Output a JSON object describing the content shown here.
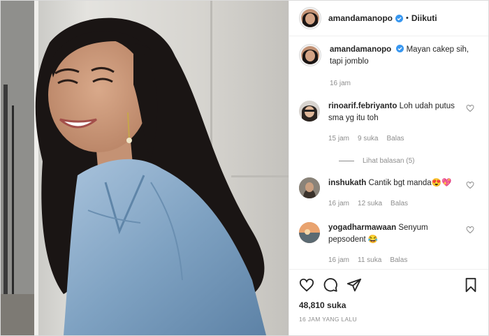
{
  "post": {
    "username": "amandamanopo",
    "follow_status": "Diikuti",
    "separator": "•"
  },
  "caption": {
    "username": "amandamanopo",
    "text": "Mayan cakep sih, tapi jomblo",
    "time": "16 jam"
  },
  "comments": [
    {
      "username": "rinoarif.febriyanto",
      "text": "Loh udah putus sma yg itu toh",
      "time": "15 jam",
      "likes": "9 suka",
      "reply": "Balas"
    },
    {
      "username": "inshukath",
      "text": "Cantik bgt manda😍💖",
      "time": "16 jam",
      "likes": "12 suka",
      "reply": "Balas"
    },
    {
      "username": "yogadharmawaan",
      "text": "Senyum pepsodent 😂",
      "time": "16 jam",
      "likes": "11 suka",
      "reply": "Balas"
    }
  ],
  "view_replies": "Lihat balasan (5)",
  "likes_count": "48,810 suka",
  "post_time": "16 JAM YANG LALU",
  "colors": {
    "verified": "#3897f0",
    "text": "#262626",
    "muted": "#8e8e8e",
    "denim": "#7ea3c4"
  },
  "icons": [
    "verified-icon",
    "heart-icon",
    "comment-icon",
    "share-icon",
    "bookmark-icon"
  ]
}
